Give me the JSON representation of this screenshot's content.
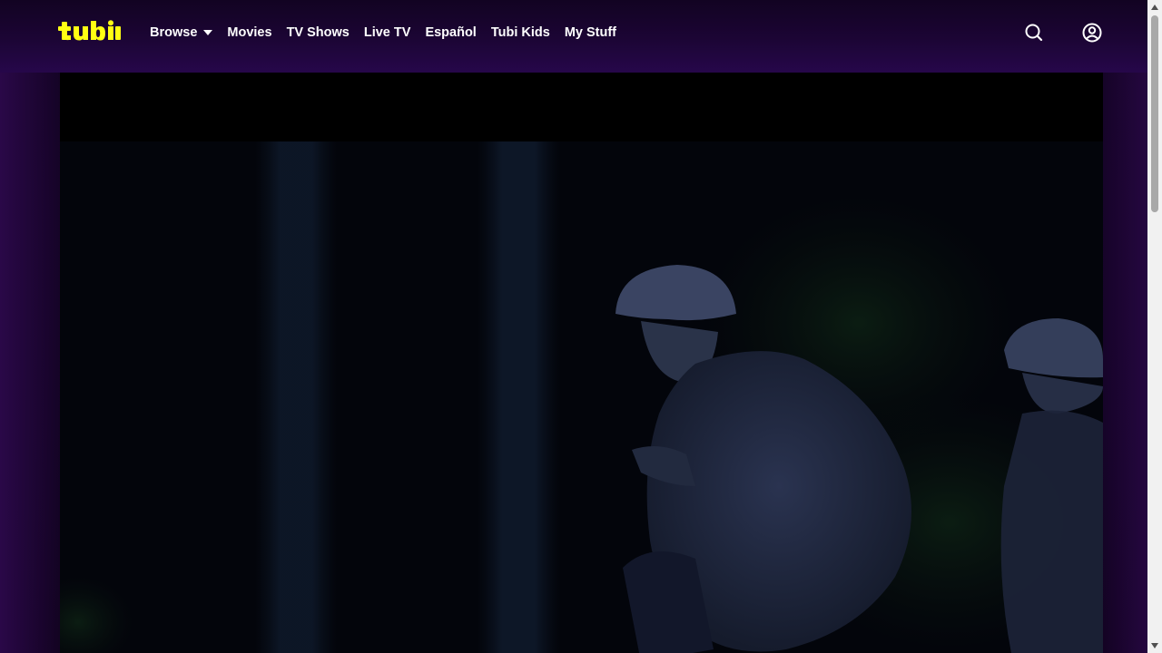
{
  "brand": {
    "logo_text": "tubi",
    "accent_color": "#ffff13"
  },
  "nav": {
    "items": [
      {
        "label": "Browse",
        "has_dropdown": true
      },
      {
        "label": "Movies"
      },
      {
        "label": "TV Shows"
      },
      {
        "label": "Live TV"
      },
      {
        "label": "Español"
      },
      {
        "label": "Tubi Kids"
      },
      {
        "label": "My Stuff"
      }
    ]
  },
  "icons": {
    "search": "search-icon",
    "account": "account-icon",
    "dropdown": "caret-down-icon"
  },
  "player": {
    "state": "playing video frame (night scene, soldiers)"
  },
  "colors": {
    "background": "#160428",
    "header": "#1c0535",
    "text": "#ffffff"
  }
}
